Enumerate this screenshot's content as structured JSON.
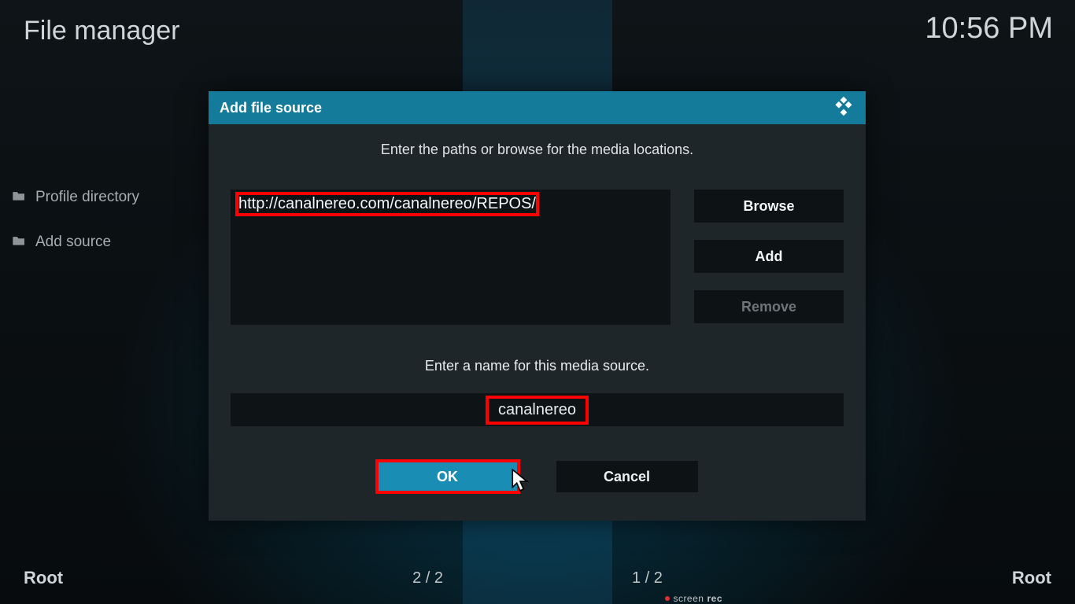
{
  "header": {
    "title": "File manager",
    "time": "10:56 PM"
  },
  "sidebar": {
    "items": [
      {
        "label": "Profile directory"
      },
      {
        "label": "Add source"
      }
    ]
  },
  "footer": {
    "left": "Root",
    "center_left": "2 / 2",
    "center_right": "1 / 2",
    "right": "Root"
  },
  "rec_badge": {
    "brand": "screen",
    "suffix": "rec"
  },
  "dialog": {
    "title": "Add file source",
    "instruction": "Enter the paths or browse for the media locations.",
    "path_value": "http://canalnereo.com/canalnereo/REPOS/",
    "browse": "Browse",
    "add": "Add",
    "remove": "Remove",
    "name_instruction": "Enter a name for this media source.",
    "name_value": "canalnereo",
    "ok": "OK",
    "cancel": "Cancel"
  }
}
